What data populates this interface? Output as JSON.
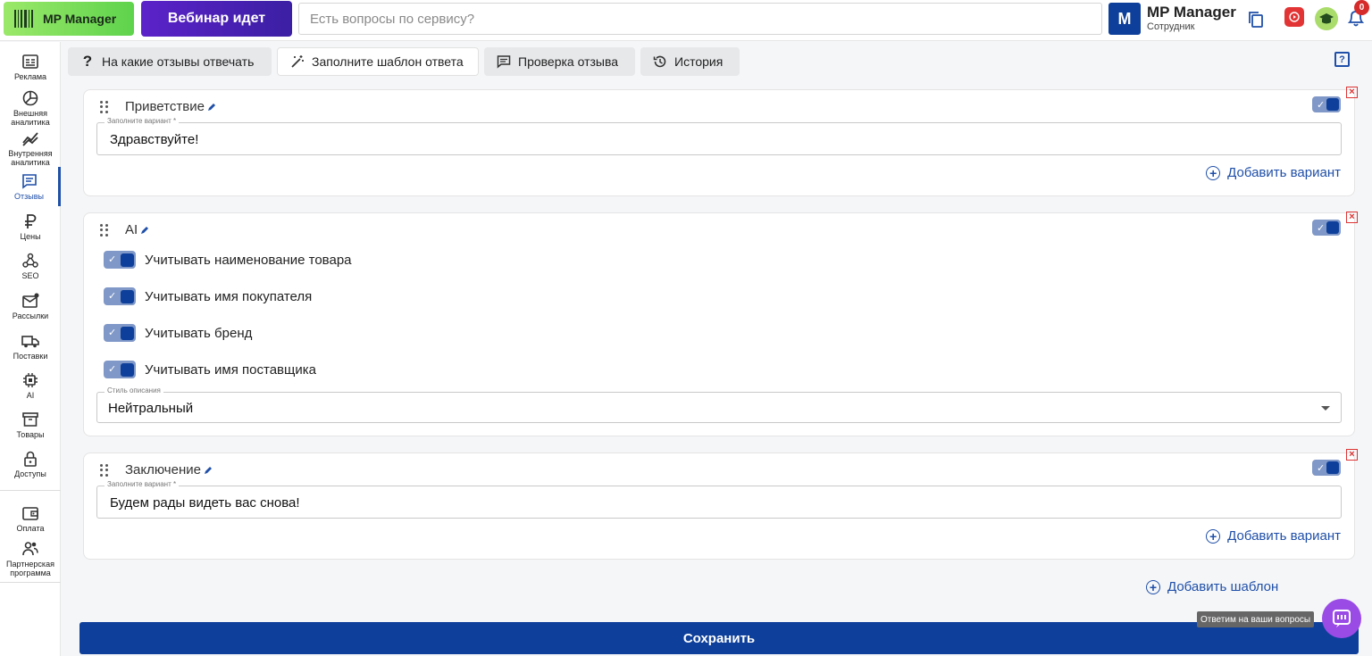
{
  "header": {
    "logo_label": "MP Manager",
    "webinar_label": "Вебинар идет",
    "search_placeholder": "Есть вопросы по сервису?",
    "avatar_letter": "M",
    "account_name": "MP Manager",
    "account_role": "Сотрудник",
    "notifications_count": "0"
  },
  "sidebar": {
    "items": [
      {
        "label": "Реклама",
        "icon": "ad-icon"
      },
      {
        "label": "Внешняя аналитика",
        "icon": "pie-chart-icon"
      },
      {
        "label": "Внутренняя аналитика",
        "icon": "trend-icon"
      },
      {
        "label": "Отзывы",
        "icon": "message-icon"
      },
      {
        "label": "Цены",
        "icon": "ruble-icon"
      },
      {
        "label": "SEO",
        "icon": "network-icon"
      },
      {
        "label": "Рассылки",
        "icon": "mail-icon"
      },
      {
        "label": "Поставки",
        "icon": "truck-icon"
      },
      {
        "label": "AI",
        "icon": "chip-icon"
      },
      {
        "label": "Товары",
        "icon": "archive-icon"
      },
      {
        "label": "Доступы",
        "icon": "lock-icon"
      },
      {
        "label": "Оплата",
        "icon": "wallet-icon"
      },
      {
        "label": "Партнерская программа",
        "icon": "people-icon"
      }
    ]
  },
  "tabs": [
    {
      "label": "На какие отзывы отвечать",
      "icon": "question-icon"
    },
    {
      "label": "Заполните шаблон ответа",
      "icon": "magic-wand-icon"
    },
    {
      "label": "Проверка отзыва",
      "icon": "comment-icon"
    },
    {
      "label": "История",
      "icon": "history-icon"
    }
  ],
  "cards": {
    "greeting": {
      "title": "Приветствие",
      "field_label": "Заполните вариант *",
      "field_value": "Здравствуйте!",
      "add_variant": "Добавить вариант"
    },
    "ai": {
      "title": "AI",
      "options": [
        "Учитывать наименование товара",
        "Учитывать имя покупателя",
        "Учитывать бренд",
        "Учитывать имя поставщика"
      ],
      "style_label": "Стиль описания",
      "style_value": "Нейтральный"
    },
    "closing": {
      "title": "Заключение",
      "field_label": "Заполните вариант *",
      "field_value": "Будем рады видеть вас снова!",
      "add_variant": "Добавить вариант"
    }
  },
  "add_template": "Добавить шаблон",
  "save_label": "Сохранить",
  "chat_tooltip": "Ответим на ваши вопросы",
  "colors": {
    "primary": "#0e3f9a",
    "link": "#1f4fa8",
    "logo_green": "#6ad64f",
    "webinar_purple": "#4a20b8",
    "chat_purple": "#9a4be6",
    "delete_red": "#dd3333"
  }
}
